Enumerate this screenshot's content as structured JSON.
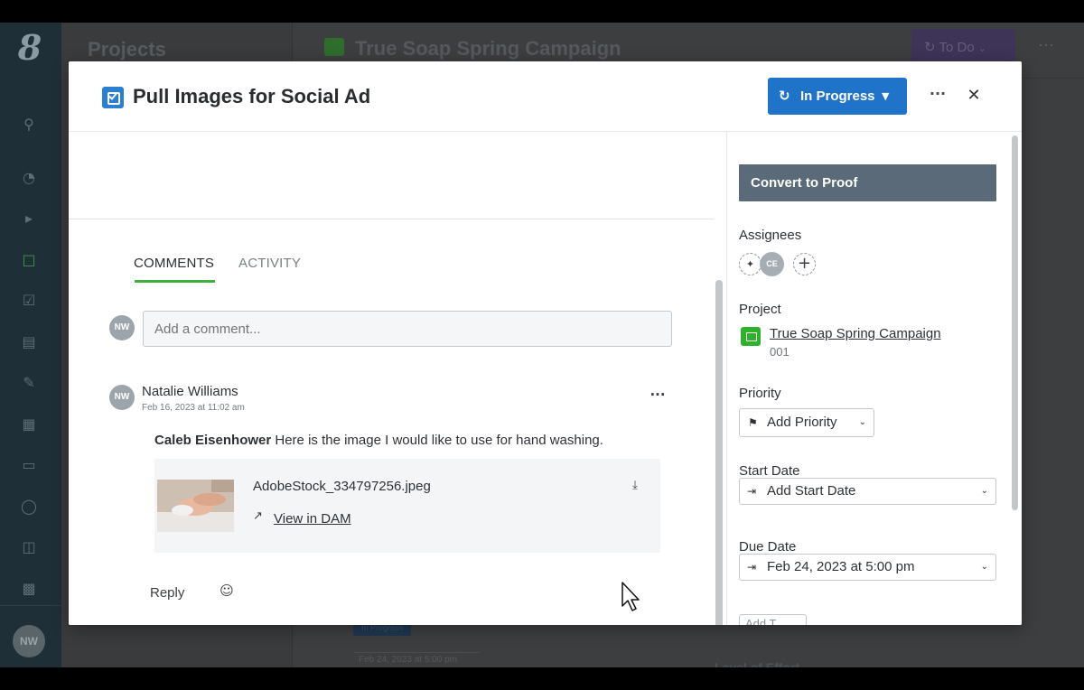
{
  "app": {
    "logo": "8",
    "user_initials": "NW",
    "projects_title": "Projects",
    "campaign_title": "True Soap Spring Campaign",
    "todo_label": "To Do",
    "more": "···",
    "bg_badge": "In Progress",
    "bg_due": "Feb 24, 2023 at 5:00 pm",
    "bg_level": "Level of Effort"
  },
  "modal": {
    "title": "Pull Images for Social Ad",
    "status_label": "In Progress",
    "more": "···",
    "close": "✕"
  },
  "tabs": {
    "comments": "COMMENTS",
    "activity": "ACTIVITY"
  },
  "composer": {
    "avatar": "NW",
    "placeholder": "Add a comment..."
  },
  "comment": {
    "avatar": "NW",
    "author": "Natalie Williams",
    "timestamp": "Feb 16, 2023 at 11:02 am",
    "more": "···",
    "mention": "Caleb Eisenhower",
    "text": " Here is the image I would like to use for hand washing.",
    "attachment": {
      "file_name": "AdobeStock_334797256.jpeg",
      "link": "View in DAM"
    },
    "reply": "Reply"
  },
  "sidebar": {
    "convert": "Convert to Proof",
    "assignees_label": "Assignees",
    "assignee_initials": "CE",
    "project_label": "Project",
    "project_name": "True Soap Spring Campaign",
    "project_number": "001",
    "priority_label": "Priority",
    "priority_btn": "Add Priority",
    "start_label": "Start Date",
    "start_value": "Add Start Date",
    "due_label": "Due Date",
    "due_value": "Feb 24, 2023 at 5:00 pm",
    "partial_btn": "Add T"
  },
  "colors": {
    "status": "#1f73c9",
    "task_icon": "#2a7fd0",
    "tab_underline": "#3fae3c",
    "project_icon": "#2fb12d",
    "convert_button": "#5a6a78"
  },
  "icons": {
    "rail": [
      "search-icon",
      "gauge-icon",
      "megaphone-icon",
      "folder-icon",
      "checkbox-icon",
      "inbox-icon",
      "document-edit-icon",
      "calendar-icon",
      "resources-icon",
      "person-icon",
      "layout-icon",
      "analytics-icon"
    ],
    "status": "refresh-icon",
    "download": "download-icon",
    "external": "external-link-icon",
    "emoji": "emoji-add-icon",
    "priority": "flag-icon",
    "date": "calendar-arrow-icon"
  }
}
